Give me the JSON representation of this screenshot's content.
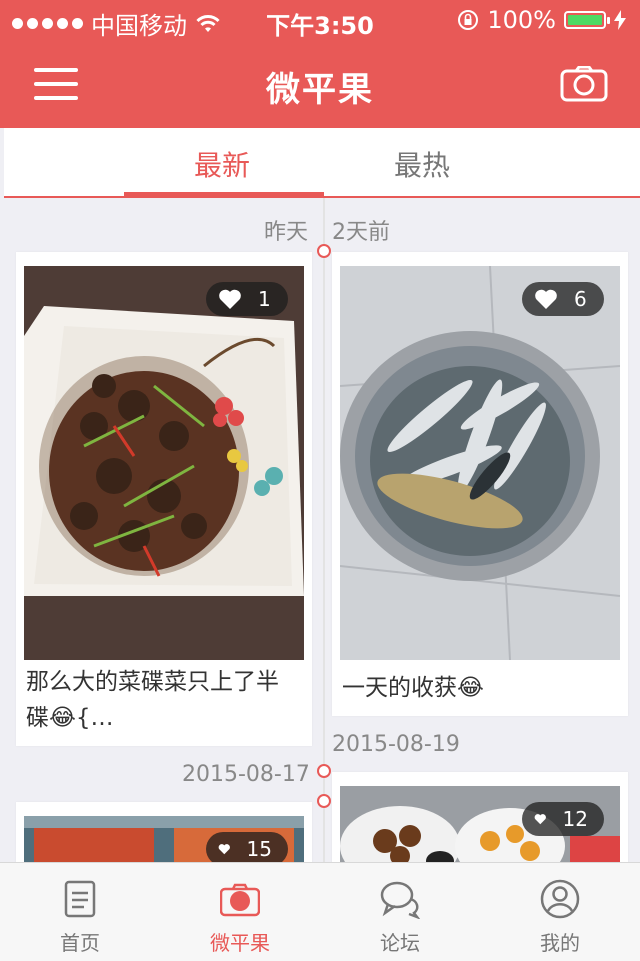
{
  "status_bar": {
    "carrier": "中国移动",
    "time": "下午3:50",
    "battery": "100%"
  },
  "header": {
    "title": "微平果",
    "menu_icon": "hamburger-menu-icon",
    "camera_icon": "camera-icon"
  },
  "tabs": [
    {
      "label": "最新",
      "active": true
    },
    {
      "label": "最热",
      "active": false
    }
  ],
  "feed": {
    "left_dates": [
      "昨天",
      "2015-08-17"
    ],
    "right_dates": [
      "2天前",
      "2015-08-19"
    ],
    "posts": [
      {
        "likes": "1",
        "caption_line1": "那么大的菜碟菜只上了半",
        "caption_line2": "碟😂{…"
      },
      {
        "likes": "6",
        "caption_line1": "一天的收获😂"
      },
      {
        "likes": "15"
      },
      {
        "likes": "12"
      }
    ]
  },
  "tabbar": {
    "items": [
      {
        "label": "首页",
        "icon": "document-icon",
        "active": false
      },
      {
        "label": "微平果",
        "icon": "camera-icon",
        "active": true
      },
      {
        "label": "论坛",
        "icon": "chat-bubbles-icon",
        "active": false
      },
      {
        "label": "我的",
        "icon": "user-profile-icon",
        "active": false
      }
    ]
  },
  "colors": {
    "accent": "#e85957",
    "inactive_text": "#777777",
    "background": "#efeff4"
  }
}
